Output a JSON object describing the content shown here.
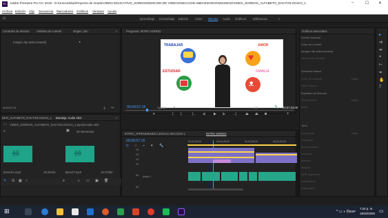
{
  "window": {
    "title": "Adobe Premiere Pro CC 2019 - D:\\Unicordoba\\Proyecto de Grado\\VIDEO EDUCATIVO_SORDOS\\EDICION DE VIDEOS\\SECCION ABECEDARIO\\INSUMOS\\VIDEO_SORDOS_ALFABETO_DACTIOLOGICO_1",
    "min": "–",
    "max": "☐",
    "close": "✕",
    "app_logo": "Pr"
  },
  "menu": [
    "Archivo",
    "Edición",
    "Clip",
    "Secuencia",
    "Marcadores",
    "Gráficos",
    "Ventana",
    "Ayuda"
  ],
  "workspaces": {
    "items": [
      "Aprendizaje",
      "Ensamblaje",
      "Edición",
      "Color",
      "Efectos",
      "Audio",
      "Gráficos",
      "Bibliotecas"
    ],
    "active": "Efectos",
    "more": "»"
  },
  "source_panel": {
    "tabs": [
      "Controles de efectos",
      "Ámbitos de Lumetri",
      "Origen: (sin",
      "»"
    ],
    "no_clip": "(ningún clip seleccionado)",
    "timecode": "00;00;57;15"
  },
  "program_panel": {
    "title": "Programa: INTRO SORDO",
    "timecode": "00;00;57;15",
    "fit": "Ajustar",
    "quality": "1/2",
    "duration": "00;07;33;09",
    "video_text": {
      "trabajar": "TRABAJAR",
      "amor": "AMOR",
      "estudiar": "ESTUDIAR",
      "familia": "FAMILIA"
    }
  },
  "project_panel": {
    "tabs": [
      "DEO_ALFABETO_DACTIOLOGICO_1",
      "Bandeja: Audio ABC",
      "»"
    ],
    "path": "VIDEO_SORDOS_ALFABETO_DACTIOLOGICO_1.prproj\\Audio ABC",
    "count": "28 elementos",
    "items": [
      {
        "name": "bo%ehA.mp3",
        "duration": "16:20104"
      },
      {
        "name": "bj%e2T.mp3",
        "duration": "16:17064"
      }
    ]
  },
  "timeline": {
    "tabs": [
      "INTRO_APRENDIENDO LENGUA SECCION 1",
      "INTRO SORDO"
    ],
    "timecode": "00;00;57;15",
    "ruler": [
      "00;00;39;29",
      "00;00;49;29",
      "00;00;59;29",
      "00;01;09;29"
    ],
    "tracks": [
      "V4",
      "V3",
      "V2",
      "V1",
      "A1",
      "A2"
    ],
    "audio_label": "Audio 1"
  },
  "essential_graphics": {
    "title": "Gráficos esenciales",
    "rows": [
      "Sonido esencial",
      "Color de Lumetri",
      "(ningún clip seleccionado)",
      "Vinculación flexible",
      "Duración básica",
      "Color de entrada",
      "Hacer blanco",
      "Equilibrio de blancos",
      "Temperatura",
      "Matiz",
      "Tono",
      "Exposición",
      "Contraste",
      "Iluminaciones",
      "Sombras",
      "Blancos",
      "Negros",
      "HDR especular",
      "Restablecer",
      "Saturación"
    ],
    "values": [
      "Nada",
      "Nada",
      "Nada"
    ]
  },
  "taskbar": {
    "time": "7:24 p. m.",
    "date": "19/10/2020",
    "lang": "ESP"
  },
  "colors": {
    "accent": "#4b9cff",
    "playhead": "#4b9cff",
    "video_clip": "#7d70c7",
    "audio_clip": "#27a78a",
    "in_out": "#ffd54a"
  }
}
